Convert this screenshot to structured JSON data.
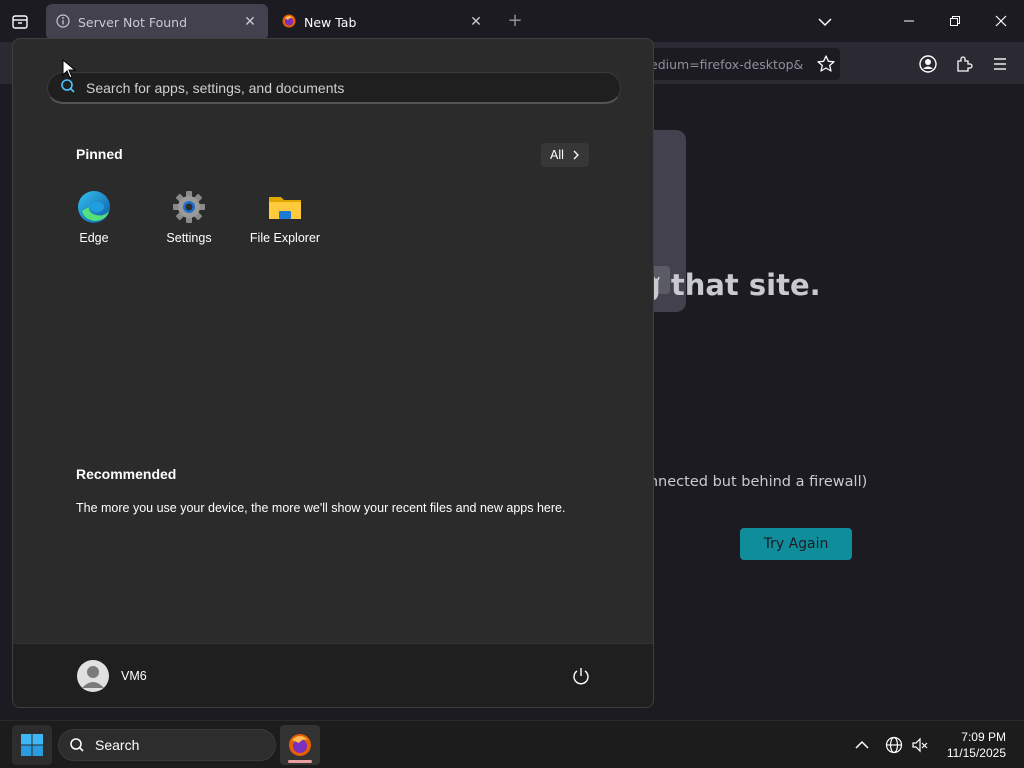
{
  "browser": {
    "tabs": [
      {
        "label": "Server Not Found",
        "active": true
      },
      {
        "label": "New Tab",
        "active": false
      }
    ],
    "url_fragment": "edium=firefox-desktop&",
    "error_heading": "g that site.",
    "error_line": "onnected but behind a firewall)",
    "error_card_button": "v",
    "try_again": "Try Again"
  },
  "start_menu": {
    "search_placeholder": "Search for apps, settings, and documents",
    "pinned_title": "Pinned",
    "all_label": "All",
    "pinned_apps": [
      {
        "label": "Edge",
        "icon": "edge-icon"
      },
      {
        "label": "Settings",
        "icon": "settings-gear-icon"
      },
      {
        "label": "File Explorer",
        "icon": "folder-icon"
      }
    ],
    "recommended_title": "Recommended",
    "recommended_text": "The more you use your device, the more we'll show your recent files and new apps here.",
    "user_name": "VM6"
  },
  "taskbar": {
    "search_label": "Search",
    "time": "7:09 PM",
    "date": "11/15/2025"
  },
  "colors": {
    "accent": "#0f8d9a",
    "start_bg": "#2b2b2b",
    "taskbar_bg": "#1c1c1c"
  }
}
